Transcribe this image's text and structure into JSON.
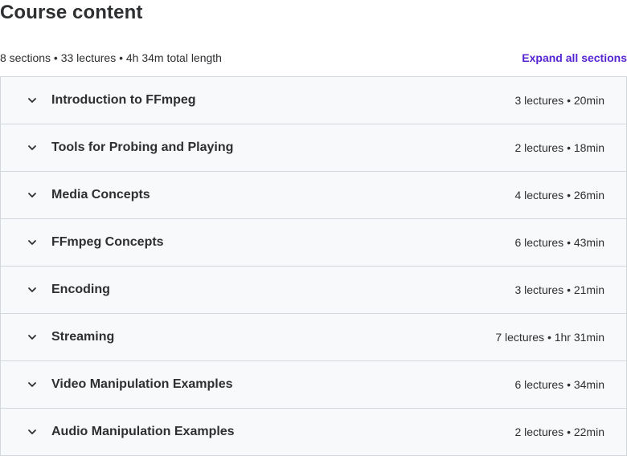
{
  "header": {
    "title": "Course content"
  },
  "summary": {
    "text": "8 sections • 33 lectures • 4h 34m total length",
    "expand_label": "Expand all sections"
  },
  "colors": {
    "accent": "#5624d0",
    "section_background": "#f7f9fa",
    "border": "#d1d7dc",
    "text": "#2d2f31"
  },
  "sections": [
    {
      "title": "Introduction to FFmpeg",
      "meta": "3 lectures • 20min",
      "icon": "chevron-down-icon"
    },
    {
      "title": "Tools for Probing and Playing",
      "meta": "2 lectures • 18min",
      "icon": "chevron-down-icon"
    },
    {
      "title": "Media Concepts",
      "meta": "4 lectures • 26min",
      "icon": "chevron-down-icon"
    },
    {
      "title": "FFmpeg Concepts",
      "meta": "6 lectures • 43min",
      "icon": "chevron-down-icon"
    },
    {
      "title": "Encoding",
      "meta": "3 lectures • 21min",
      "icon": "chevron-down-icon"
    },
    {
      "title": "Streaming",
      "meta": "7 lectures • 1hr 31min",
      "icon": "chevron-down-icon"
    },
    {
      "title": "Video Manipulation Examples",
      "meta": "6 lectures • 34min",
      "icon": "chevron-down-icon"
    },
    {
      "title": "Audio Manipulation Examples",
      "meta": "2 lectures • 22min",
      "icon": "chevron-down-icon"
    }
  ]
}
